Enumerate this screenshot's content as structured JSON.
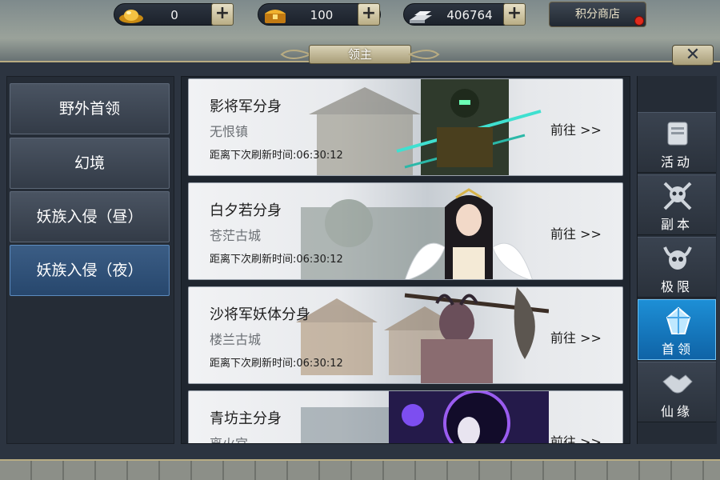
{
  "currency": {
    "gold": {
      "icon": "gold-ingot-icon",
      "value": "0"
    },
    "coupon": {
      "icon": "treasure-chest-icon",
      "value": "100"
    },
    "silver": {
      "icon": "silver-bars-icon",
      "value": "406764"
    }
  },
  "shop_label": "积分商店",
  "panel_title": "领主",
  "close_label": "✕",
  "categories": [
    {
      "label": "野外首领"
    },
    {
      "label": "幻境"
    },
    {
      "label": "妖族入侵（昼）"
    },
    {
      "label": "妖族入侵（夜）"
    }
  ],
  "bosses": [
    {
      "name": "影将军分身",
      "location": "无恨镇",
      "timer": "距离下次刷新时间:06:30:12",
      "go": "前往 >>"
    },
    {
      "name": "白夕若分身",
      "location": "苍茫古城",
      "timer": "距离下次刷新时间:06:30:12",
      "go": "前往 >>"
    },
    {
      "name": "沙将军妖体分身",
      "location": "楼兰古城",
      "timer": "距离下次刷新时间:06:30:12",
      "go": "前往 >>"
    },
    {
      "name": "青坊主分身",
      "location": "离火宫",
      "timer": "",
      "go": "前往 >>"
    }
  ],
  "side_tabs": [
    {
      "label": "活动",
      "icon": "activity-scroll-icon"
    },
    {
      "label": "副本",
      "icon": "skull-crossed-swords-icon"
    },
    {
      "label": "极限",
      "icon": "horned-skull-icon"
    },
    {
      "label": "首领",
      "icon": "crystal-crown-icon"
    },
    {
      "label": "仙缘",
      "icon": "handshake-icon"
    }
  ],
  "colors": {
    "active_tab": "#1d8fd6",
    "active_category": "#27476d",
    "notification": "#e02a1c"
  }
}
